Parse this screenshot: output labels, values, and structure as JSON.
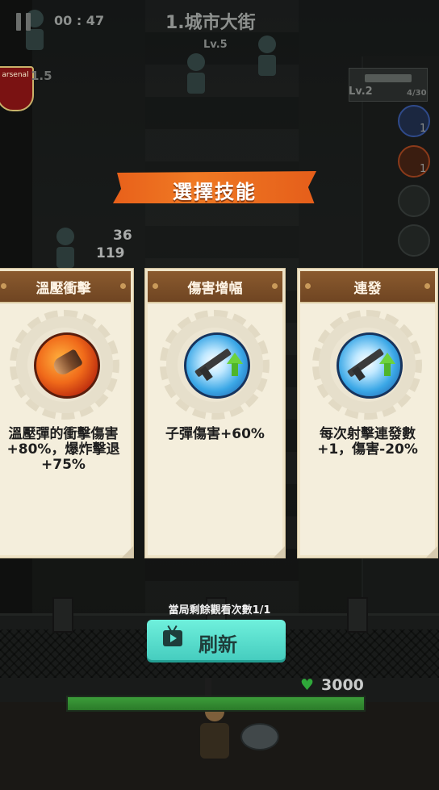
{
  "hud": {
    "timer": "00 : 47",
    "level_title": "1.城市大街",
    "boss_level": "Lv.5",
    "badge_text": "arsenal",
    "badge_level": "1.5",
    "weapon_level": "Lv.2",
    "ammo": "4/30",
    "slots": [
      {
        "count": "1"
      },
      {
        "count": "1"
      },
      {
        "count": ""
      },
      {
        "count": ""
      }
    ],
    "damage_numbers": [
      "36",
      "119"
    ]
  },
  "dialog": {
    "title": "選擇技能",
    "cards": [
      {
        "name": "溫壓衝擊",
        "icon": "thermobaric-bullet-icon",
        "description": "溫壓彈的衝擊傷害+80%，爆炸擊退+75%"
      },
      {
        "name": "傷害增幅",
        "icon": "rifle-upgrade-icon",
        "description": "子彈傷害+60%"
      },
      {
        "name": "連發",
        "icon": "rifle-upgrade-icon",
        "description": "每次射擊連發數+1，傷害-20%"
      }
    ],
    "views_remaining": "當局剩餘觀看次數1/1",
    "refresh_label": "刷新"
  },
  "player": {
    "hp": "3000",
    "hp_fraction": 1.0
  },
  "colors": {
    "banner": "#f07a24",
    "refresh_button": "#5fe3d2",
    "health": "#2fa83a",
    "card_header": "#7a4d26"
  }
}
